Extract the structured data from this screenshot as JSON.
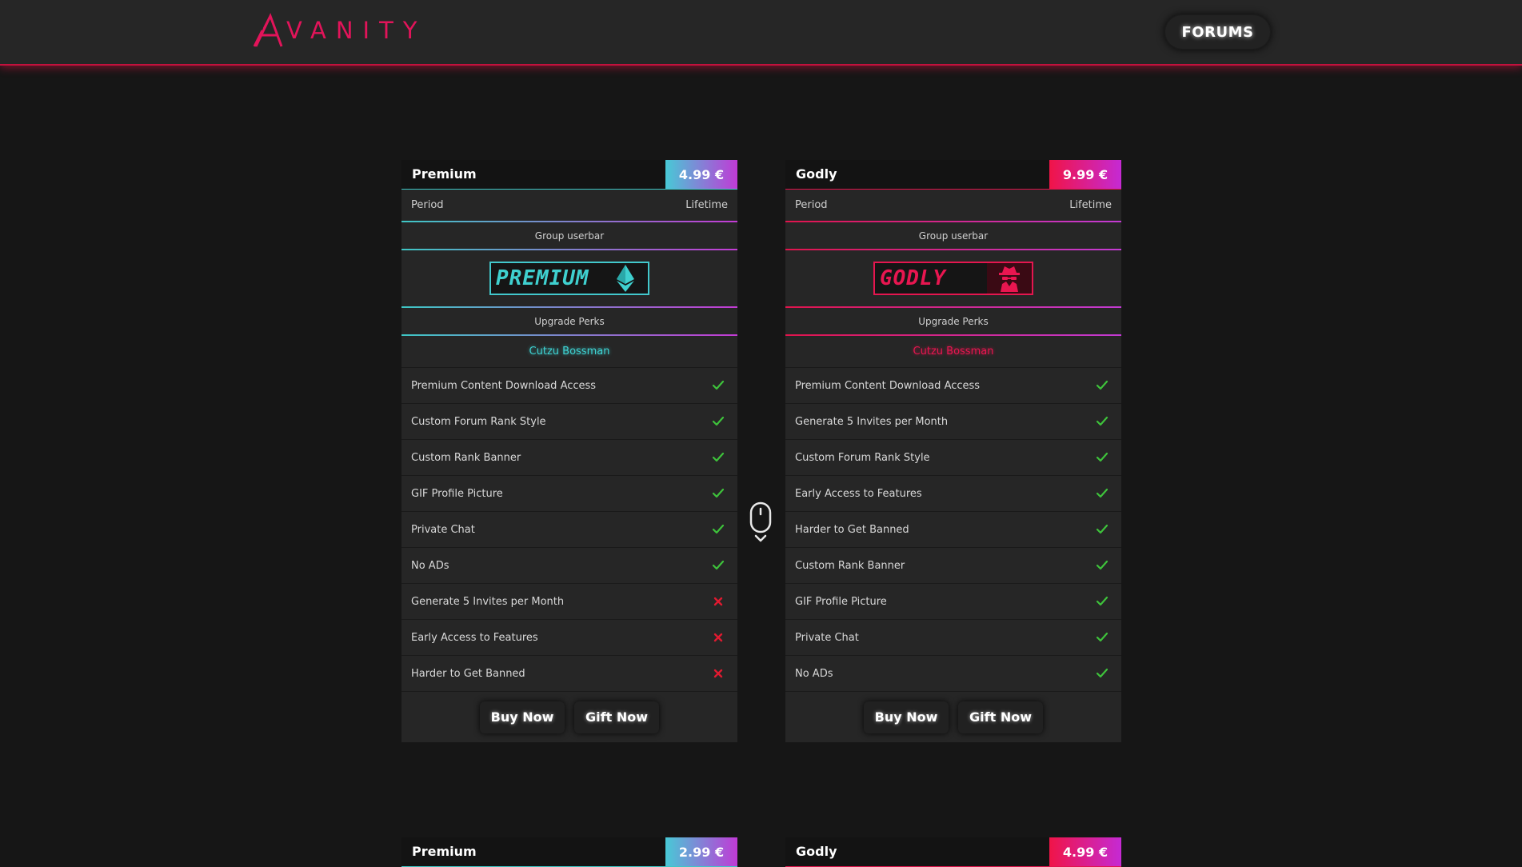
{
  "header": {
    "logo_text": "VANITY",
    "forums_label": "FORUMS"
  },
  "colors": {
    "accent_red": "#e2145a",
    "accent_cyan": "#3ec7c5",
    "accent_purple": "#c33bd4",
    "check_green": "#3ec23b",
    "cross_red": "#e01a30"
  },
  "cards": [
    {
      "name": "Premium",
      "price": "4.99 €",
      "period_label": "Period",
      "period_value": "Lifetime",
      "userbar_section": "Group userbar",
      "userbar_text": "PREMIUM",
      "userbar_icon": "ethereum-icon",
      "perks_section": "Upgrade Perks",
      "sample_username": "Cutzu Bossman",
      "perks": [
        {
          "label": "Premium Content Download Access",
          "included": true
        },
        {
          "label": "Custom Forum Rank Style",
          "included": true
        },
        {
          "label": "Custom Rank Banner",
          "included": true
        },
        {
          "label": "GIF Profile Picture",
          "included": true
        },
        {
          "label": "Private Chat",
          "included": true
        },
        {
          "label": "No ADs",
          "included": true
        },
        {
          "label": "Generate 5 Invites per Month",
          "included": false
        },
        {
          "label": "Early Access to Features",
          "included": false
        },
        {
          "label": "Harder to Get Banned",
          "included": false
        }
      ],
      "buy_label": "Buy Now",
      "gift_label": "Gift Now"
    },
    {
      "name": "Godly",
      "price": "9.99 €",
      "period_label": "Period",
      "period_value": "Lifetime",
      "userbar_section": "Group userbar",
      "userbar_text": "GODLY",
      "userbar_icon": "spy-icon",
      "perks_section": "Upgrade Perks",
      "sample_username": "Cutzu Bossman",
      "perks": [
        {
          "label": "Premium Content Download Access",
          "included": true
        },
        {
          "label": "Generate 5 Invites per Month",
          "included": true
        },
        {
          "label": "Custom Forum Rank Style",
          "included": true
        },
        {
          "label": "Early Access to Features",
          "included": true
        },
        {
          "label": "Harder to Get Banned",
          "included": true
        },
        {
          "label": "Custom Rank Banner",
          "included": true
        },
        {
          "label": "GIF Profile Picture",
          "included": true
        },
        {
          "label": "Private Chat",
          "included": true
        },
        {
          "label": "No ADs",
          "included": true
        }
      ],
      "buy_label": "Buy Now",
      "gift_label": "Gift Now"
    }
  ],
  "lower_cards": [
    {
      "name": "Premium",
      "price": "2.99 €"
    },
    {
      "name": "Godly",
      "price": "4.99 €"
    }
  ],
  "scroll_hint_icon": "mouse-scroll-icon"
}
